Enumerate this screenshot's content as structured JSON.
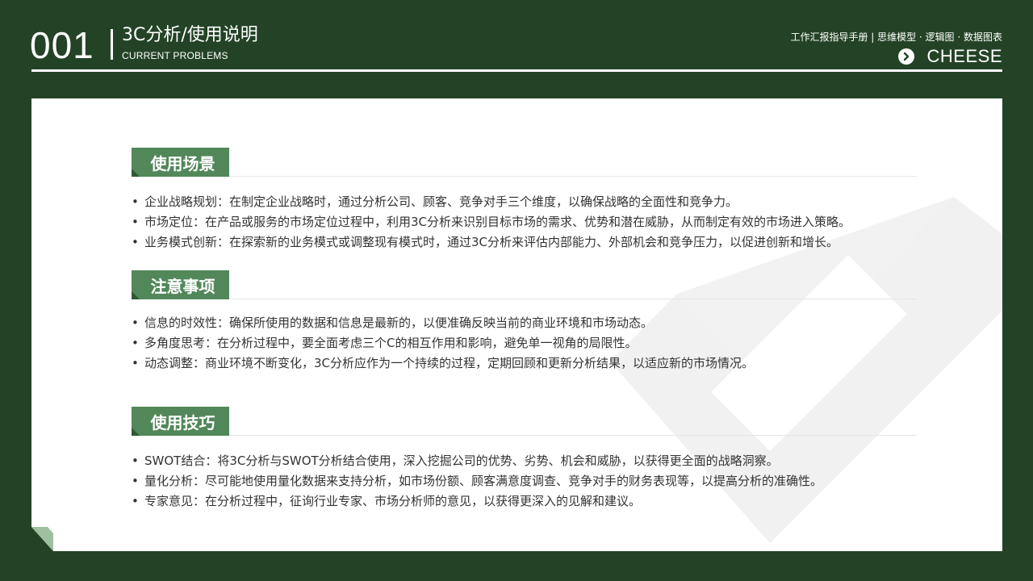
{
  "header": {
    "number": "001",
    "title": "3C分析/使用说明",
    "subtitle": "CURRENT PROBLEMS",
    "right_text": "工作汇报指导手册 | 思维模型 · 逻辑图 · 数据图表",
    "brand": "CHEESE",
    "brand_icon": "chevron-right-circle-icon"
  },
  "colors": {
    "background": "#244326",
    "accent": "#52875a",
    "card": "#ffffff"
  },
  "sections": [
    {
      "tag": "使用场景",
      "items": [
        "企业战略规划：在制定企业战略时，通过分析公司、顾客、竞争对手三个维度，以确保战略的全面性和竞争力。",
        "市场定位：在产品或服务的市场定位过程中，利用3C分析来识别目标市场的需求、优势和潜在威胁，从而制定有效的市场进入策略。",
        "业务模式创新：在探索新的业务模式或调整现有模式时，通过3C分析来评估内部能力、外部机会和竞争压力，以促进创新和增长。"
      ]
    },
    {
      "tag": "注意事项",
      "items": [
        "信息的时效性：确保所使用的数据和信息是最新的，以便准确反映当前的商业环境和市场动态。",
        "多角度思考：在分析过程中，要全面考虑三个C的相互作用和影响，避免单一视角的局限性。",
        "动态调整：商业环境不断变化，3C分析应作为一个持续的过程，定期回顾和更新分析结果，以适应新的市场情况。"
      ]
    },
    {
      "tag": "使用技巧",
      "items": [
        "SWOT结合：将3C分析与SWOT分析结合使用，深入挖掘公司的优势、劣势、机会和威胁，以获得更全面的战略洞察。",
        "量化分析：尽可能地使用量化数据来支持分析，如市场份额、顾客满意度调查、竞争对手的财务表现等，以提高分析的准确性。",
        "专家意见：在分析过程中，征询行业专家、市场分析师的意见，以获得更深入的见解和建议。"
      ]
    }
  ]
}
